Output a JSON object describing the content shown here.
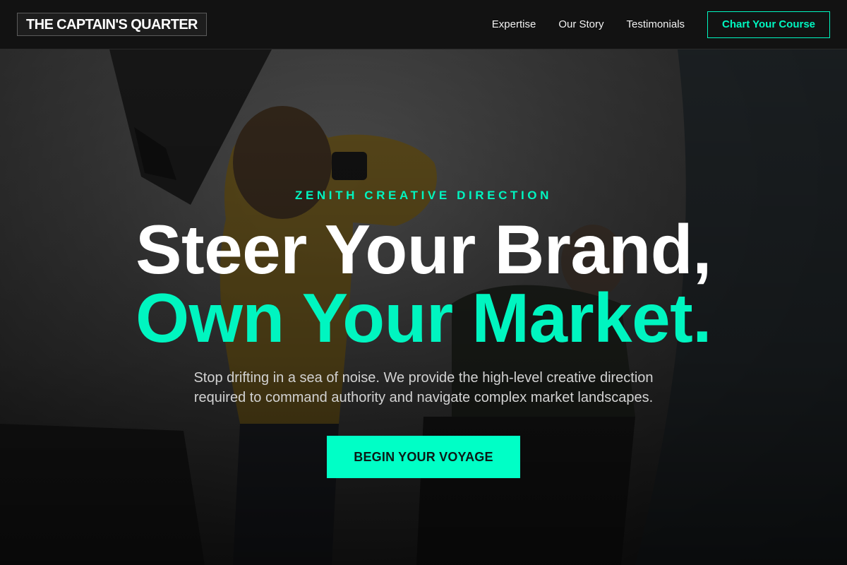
{
  "brand": {
    "name": "THE CAPTAIN'S QUARTER"
  },
  "nav": {
    "links": [
      "Expertise",
      "Our Story",
      "Testimonials"
    ],
    "cta": "Chart Your Course"
  },
  "hero": {
    "eyebrow": "ZENITH CREATIVE DIRECTION",
    "headline_line1": "Steer Your Brand,",
    "headline_line2": "Own Your Market.",
    "subtitle": "Stop drifting in a sea of noise. We provide the high-level creative direction required to command authority and navigate complex market landscapes.",
    "button": "BEGIN YOUR VOYAGE",
    "background_image": "photoshoot-studio-photo"
  },
  "colors": {
    "accent": "#00f5c0",
    "header_bg": "#121212",
    "text": "#ffffff"
  }
}
